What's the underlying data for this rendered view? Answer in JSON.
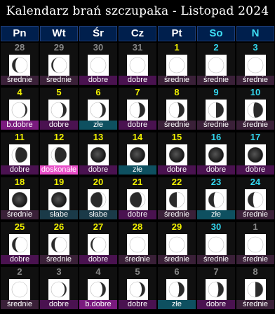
{
  "title": "Kalendarz brań szczupaka - Listopad 2024",
  "weekdays": [
    "Pn",
    "Wt",
    "Śr",
    "Cz",
    "Pt",
    "So",
    "N"
  ],
  "colors": {
    "weekday_text": "#ffffff",
    "weekend_text": "#3fe0f5",
    "day_number_current": "#f0f000",
    "day_number_weekend": "#32d8f0",
    "day_number_other_month": "#888888",
    "rating_bg": {
      "średnie": "#3a2038",
      "dobre": "#4a1250",
      "złe": "#0e5060",
      "słabe": "#1a3a48",
      "b.dobre": "#7a1a7e",
      "doskonałe": "#e84ec8"
    }
  },
  "weeks": [
    [
      {
        "day": "28",
        "month": "other",
        "rating": "średnie",
        "moon": "waning-crescent"
      },
      {
        "day": "29",
        "month": "other",
        "rating": "średnie",
        "moon": "waning-crescent-thin"
      },
      {
        "day": "30",
        "month": "other",
        "rating": "dobre",
        "moon": "new"
      },
      {
        "day": "31",
        "month": "other",
        "rating": "dobre",
        "moon": "new"
      },
      {
        "day": "1",
        "month": "current",
        "rating": "średnie",
        "moon": "new"
      },
      {
        "day": "2",
        "month": "current",
        "rating": "średnie",
        "moon": "new"
      },
      {
        "day": "3",
        "month": "current",
        "rating": "średnie",
        "moon": "new"
      }
    ],
    [
      {
        "day": "4",
        "month": "current",
        "rating": "b.dobre",
        "moon": "waxing-crescent-thin"
      },
      {
        "day": "5",
        "month": "current",
        "rating": "dobre",
        "moon": "waxing-crescent"
      },
      {
        "day": "6",
        "month": "current",
        "rating": "złe",
        "moon": "waxing-crescent"
      },
      {
        "day": "7",
        "month": "current",
        "rating": "dobre",
        "moon": "waxing-crescent-wide"
      },
      {
        "day": "8",
        "month": "current",
        "rating": "średnie",
        "moon": "waxing-crescent-wide"
      },
      {
        "day": "9",
        "month": "current",
        "rating": "średnie",
        "moon": "first-quarter"
      },
      {
        "day": "10",
        "month": "current",
        "rating": "średnie",
        "moon": "waxing-gibbous-early"
      }
    ],
    [
      {
        "day": "11",
        "month": "current",
        "rating": "dobre",
        "moon": "waxing-gibbous"
      },
      {
        "day": "12",
        "month": "current",
        "rating": "doskonałe",
        "moon": "waxing-gibbous"
      },
      {
        "day": "13",
        "month": "current",
        "rating": "dobre",
        "moon": "full"
      },
      {
        "day": "14",
        "month": "current",
        "rating": "złe",
        "moon": "full"
      },
      {
        "day": "15",
        "month": "current",
        "rating": "dobre",
        "moon": "full"
      },
      {
        "day": "16",
        "month": "current",
        "rating": "dobre",
        "moon": "full"
      },
      {
        "day": "17",
        "month": "current",
        "rating": "dobre",
        "moon": "full"
      }
    ],
    [
      {
        "day": "18",
        "month": "current",
        "rating": "średnie",
        "moon": "full"
      },
      {
        "day": "19",
        "month": "current",
        "rating": "słabe",
        "moon": "full"
      },
      {
        "day": "20",
        "month": "current",
        "rating": "słabe",
        "moon": "waning-gibbous"
      },
      {
        "day": "21",
        "month": "current",
        "rating": "dobre",
        "moon": "waning-gibbous"
      },
      {
        "day": "22",
        "month": "current",
        "rating": "średnie",
        "moon": "last-quarter"
      },
      {
        "day": "23",
        "month": "current",
        "rating": "złe",
        "moon": "last-quarter-wide"
      },
      {
        "day": "24",
        "month": "current",
        "rating": "średnie",
        "moon": "waning-crescent-wide"
      }
    ],
    [
      {
        "day": "25",
        "month": "current",
        "rating": "dobre",
        "moon": "waning-crescent"
      },
      {
        "day": "26",
        "month": "current",
        "rating": "średnie",
        "moon": "waning-crescent"
      },
      {
        "day": "27",
        "month": "current",
        "rating": "dobre",
        "moon": "waning-crescent-thin"
      },
      {
        "day": "28",
        "month": "current",
        "rating": "średnie",
        "moon": "new"
      },
      {
        "day": "29",
        "month": "current",
        "rating": "średnie",
        "moon": "new"
      },
      {
        "day": "30",
        "month": "current",
        "rating": "średnie",
        "moon": "new"
      },
      {
        "day": "1",
        "month": "other",
        "rating": "średnie",
        "moon": "new"
      }
    ],
    [
      {
        "day": "2",
        "month": "other",
        "rating": "średnie",
        "moon": "new"
      },
      {
        "day": "3",
        "month": "other",
        "rating": "dobre",
        "moon": "waxing-crescent-thin"
      },
      {
        "day": "4",
        "month": "other",
        "rating": "b.dobre",
        "moon": "waxing-crescent"
      },
      {
        "day": "5",
        "month": "other",
        "rating": "dobre",
        "moon": "waxing-crescent"
      },
      {
        "day": "6",
        "month": "other",
        "rating": "złe",
        "moon": "waxing-crescent-wide"
      },
      {
        "day": "7",
        "month": "other",
        "rating": "dobre",
        "moon": "waxing-crescent-wide"
      },
      {
        "day": "8",
        "month": "other",
        "rating": "średnie",
        "moon": "first-quarter"
      }
    ]
  ]
}
